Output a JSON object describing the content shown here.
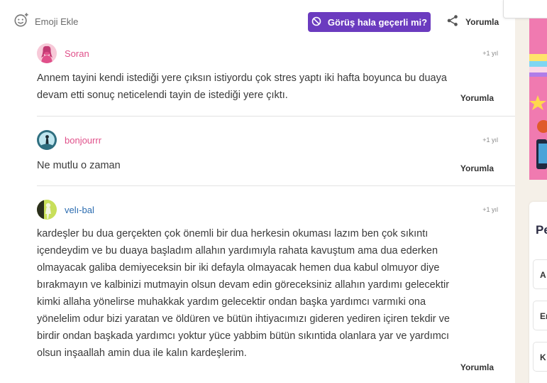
{
  "toolbar": {
    "emoji_label": "Emoji Ekle",
    "opinion_label": "Görüş hala geçerli mi?",
    "comment_label": "Yorumla"
  },
  "comments": [
    {
      "user": "Soran",
      "time": "+1 yıl",
      "text": "Annem tayini kendi istediği yere çıksın istiyordu çok stres yaptı iki hafta boyunca bu duaya devam etti sonuç neticelendi tayin de istediği yere çıktı.",
      "reply": "Yorumla"
    },
    {
      "user": "bonjourrr",
      "time": "+1 yıl",
      "text": "Ne mutlu o zaman",
      "reply": "Yorumla"
    },
    {
      "user": "velı-bal",
      "time": "+1 yıl",
      "text": "kardeşler bu dua gerçekten çok önemli bir dua herkesin okuması lazım ben çok sıkıntı içendeydim ve bu duaya başladım allahın yardımıyla rahata kavuştum ama dua ederken olmayacak galiba demiyeceksin bir iki defayla olmayacak hemen dua kabul olmuyor diye bırakmayın ve kalbinizi mutmayin olsun devam edin göreceksiniz allahın yardımı gelecektir kimki allaha yönelirse muhakkak yardım gelecektir ondan başka yardımcı varmıki ona yönelelim odur bizi yaratan ve öldüren ve bütün ihtiyacımızı gideren yediren içiren tekdir ve birdir ondan başkada yardımcı yoktur yüce yabbim bütün sıkıntida olanlara yar ve yardımcı olsun inşaallah amin dua ile kalın kardeşlerim.",
      "reply": "Yorumla"
    }
  ],
  "sidebar": {
    "panel_title": "Pe",
    "chips": [
      "A",
      "Er",
      "K"
    ]
  },
  "colors": {
    "accent": "#6b3bbf",
    "username_pink": "#e0508a",
    "username_blue": "#2b6cb0"
  }
}
